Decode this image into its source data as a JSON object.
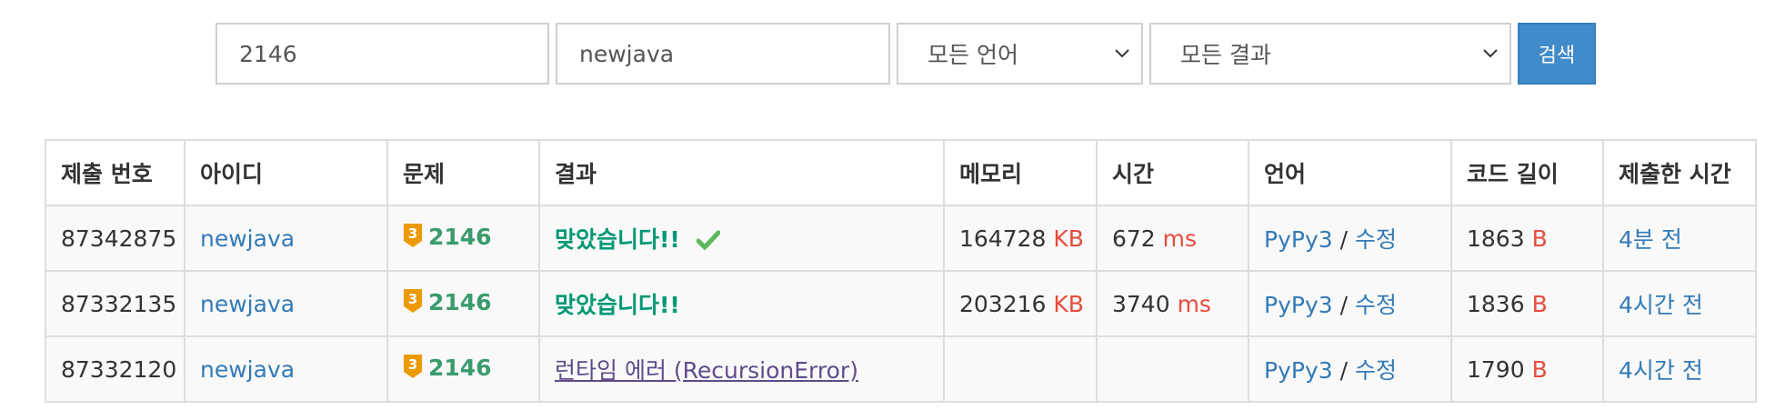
{
  "search": {
    "problem_value": "2146",
    "user_value": "newjava",
    "language_label": "모든 언어",
    "result_label": "모든 결과",
    "button_label": "검색"
  },
  "table": {
    "headers": [
      "제출 번호",
      "아이디",
      "문제",
      "결과",
      "메모리",
      "시간",
      "언어",
      "코드 길이",
      "제출한 시간"
    ],
    "rows": [
      {
        "id": "87342875",
        "user": "newjava",
        "tier": "3",
        "problem": "2146",
        "result": "맞았습니다!!",
        "result_type": "accepted",
        "memory": "164728",
        "memory_unit": "KB",
        "time": "672",
        "time_unit": "ms",
        "language": "PyPy3",
        "edit": "수정",
        "code_length": "1863",
        "code_unit": "B",
        "submitted": "4분 전"
      },
      {
        "id": "87332135",
        "user": "newjava",
        "tier": "3",
        "problem": "2146",
        "result": "맞았습니다!!",
        "result_type": "accepted",
        "memory": "203216",
        "memory_unit": "KB",
        "time": "3740",
        "time_unit": "ms",
        "language": "PyPy3",
        "edit": "수정",
        "code_length": "1836",
        "code_unit": "B",
        "submitted": "4시간 전"
      },
      {
        "id": "87332120",
        "user": "newjava",
        "tier": "3",
        "problem": "2146",
        "result": "런타임 에러 (RecursionError)",
        "result_type": "runtime-error",
        "memory": "",
        "memory_unit": "",
        "time": "",
        "time_unit": "",
        "language": "PyPy3",
        "edit": "수정",
        "code_length": "1790",
        "code_unit": "B",
        "submitted": "4시간 전"
      }
    ]
  },
  "colors": {
    "accepted": "#009874",
    "link": "#337ab7",
    "unit": "#e74c3c",
    "runtime_error": "#5f4b8b",
    "tier_gold": "#ec9a00",
    "button": "#428bca"
  },
  "icons": {
    "tier_badge": "gold-tier-badge-icon",
    "accepted_check": "check-mark-icon",
    "dropdown": "chevron-down-icon"
  }
}
